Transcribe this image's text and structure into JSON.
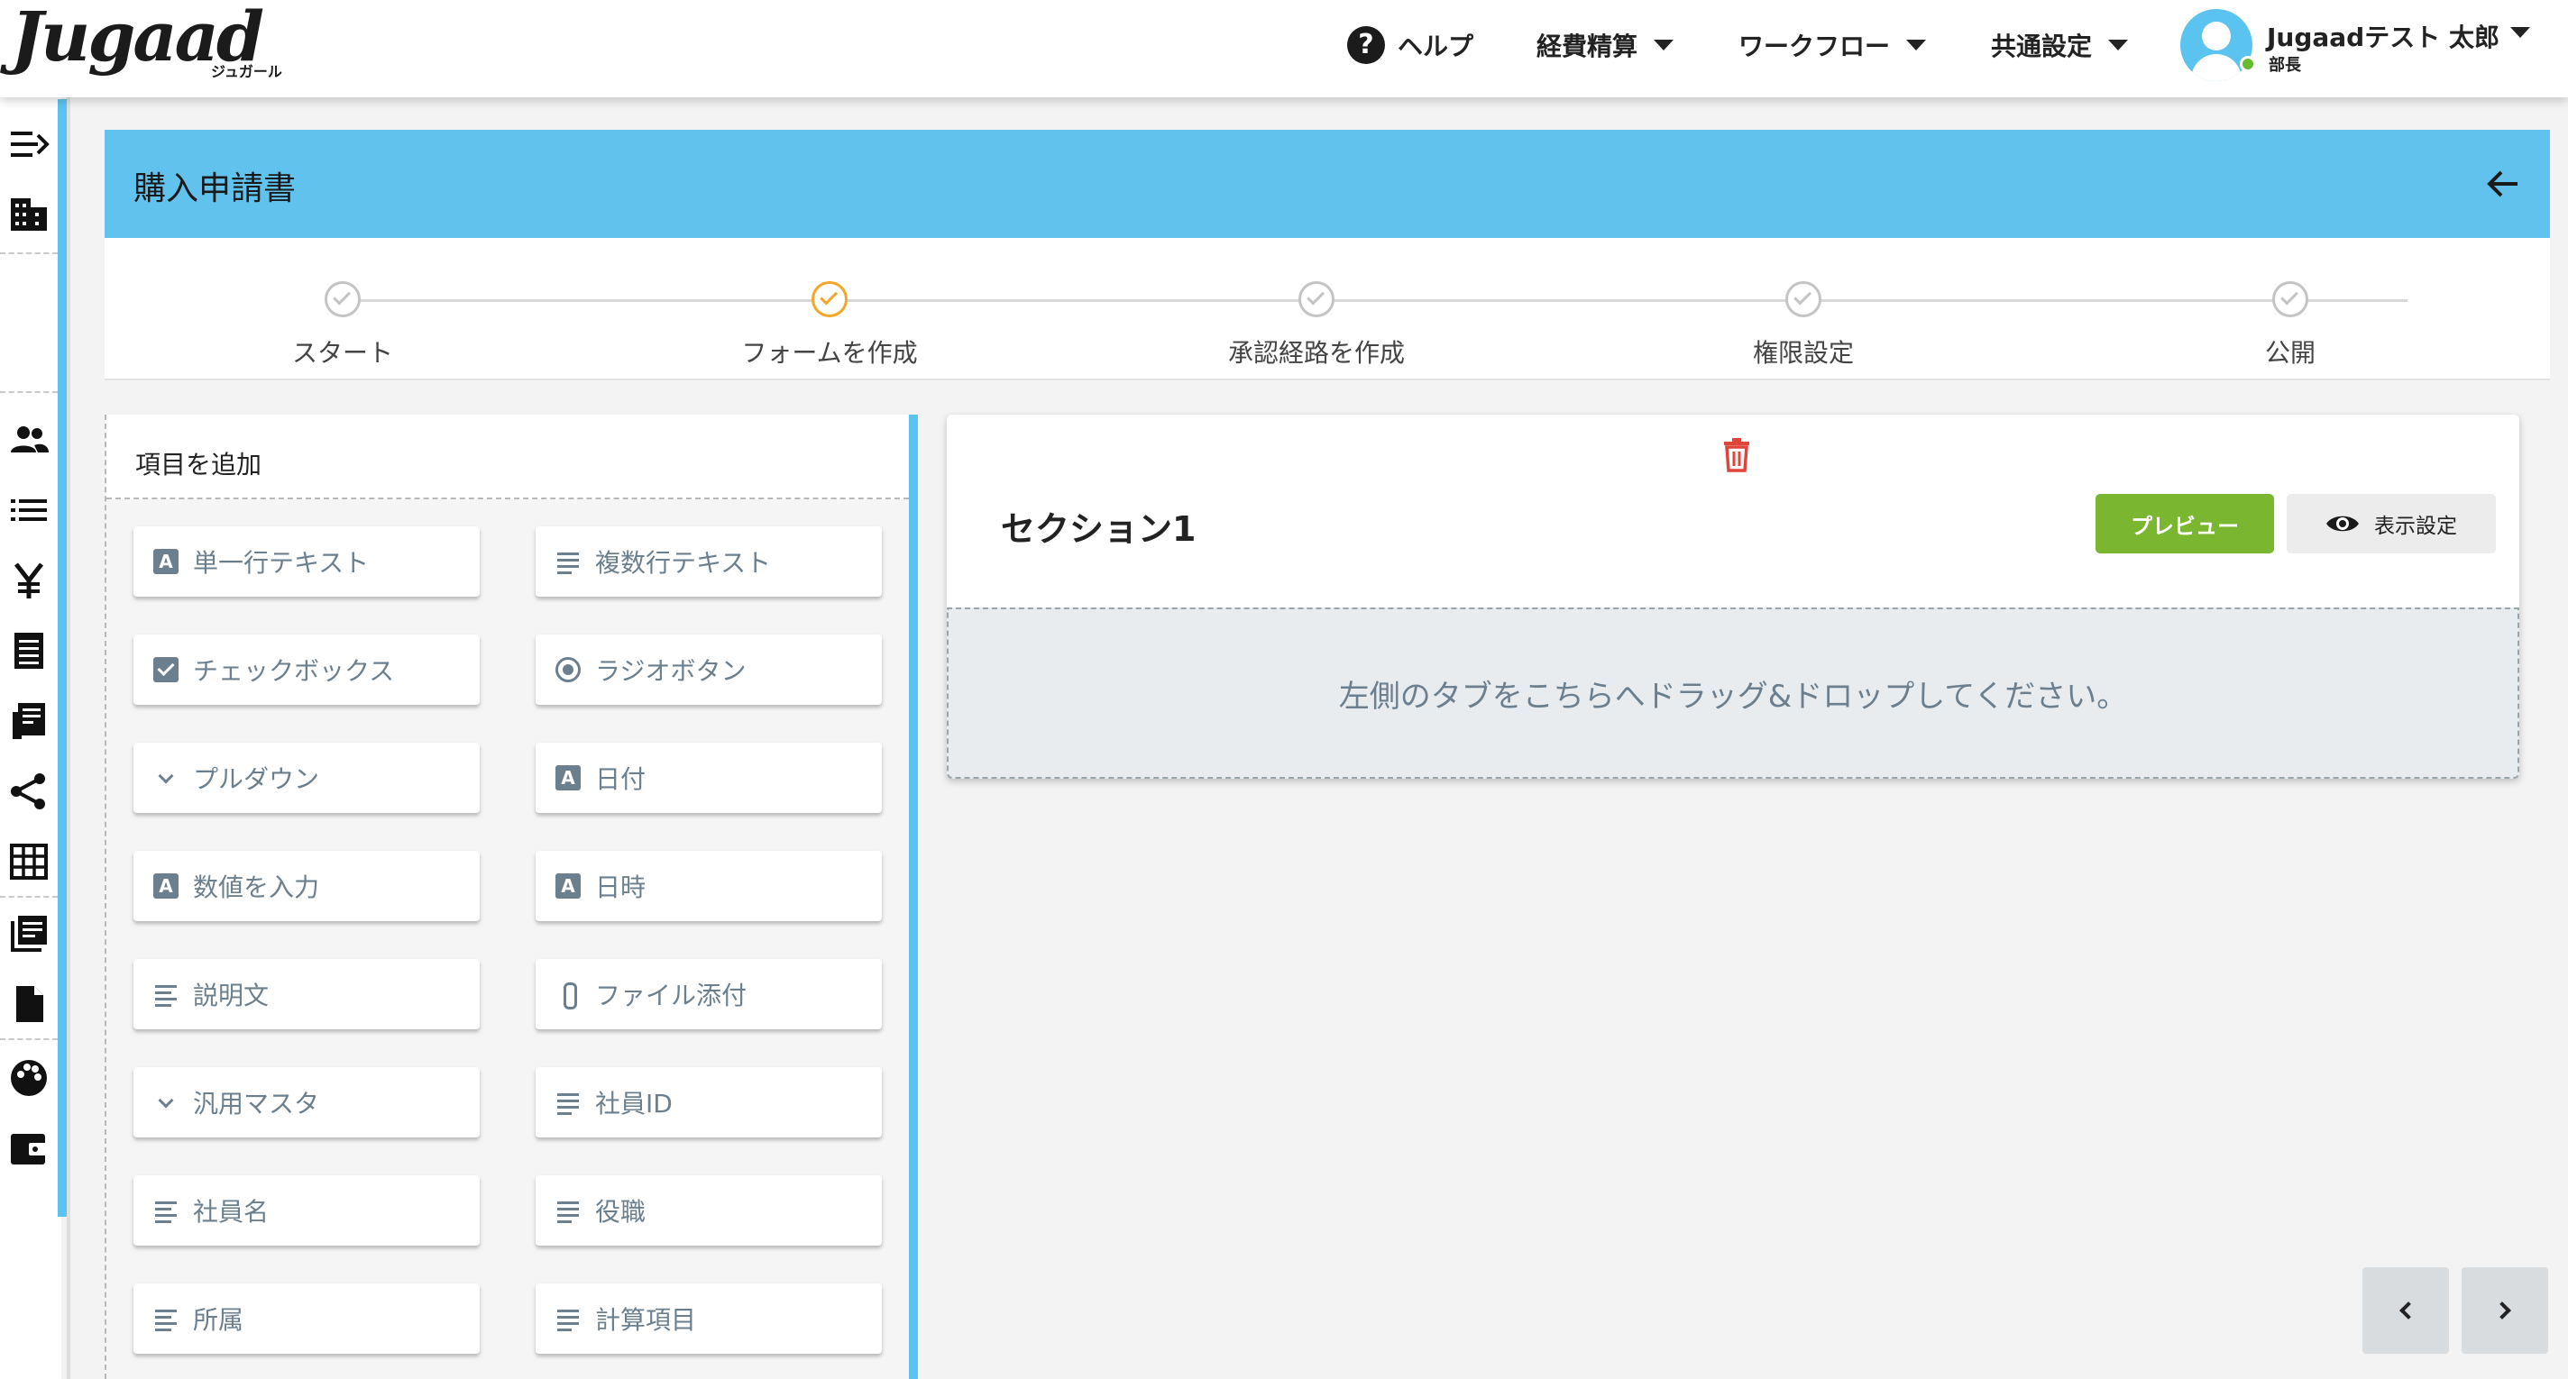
{
  "app": {
    "logo_text": "Jugaad",
    "logo_sub": "ジュガール"
  },
  "header": {
    "help_label": "ヘルプ",
    "menus": [
      "経費精算",
      "ワークフロー",
      "共通設定"
    ],
    "user": {
      "name": "Jugaadテスト 太郎",
      "role": "部長",
      "status_color": "#66bb2e"
    }
  },
  "sidebar": {
    "icons": [
      "collapse-menu-icon",
      "building-icon",
      "users-icon",
      "list-icon",
      "yen-icon",
      "receipt-icon",
      "invoice-icon",
      "share-icon",
      "table-icon",
      "library-icon",
      "document-icon",
      "palette-icon",
      "wallet-icon"
    ]
  },
  "page": {
    "title": "購入申請書"
  },
  "stepper": {
    "steps": [
      {
        "label": "スタート",
        "state": "done"
      },
      {
        "label": "フォームを作成",
        "state": "active"
      },
      {
        "label": "承認経路を作成",
        "state": "pending"
      },
      {
        "label": "権限設定",
        "state": "pending"
      },
      {
        "label": "公開",
        "state": "pending"
      }
    ],
    "active_color": "#f3a628"
  },
  "palette": {
    "title": "項目を追加",
    "items": [
      {
        "label": "単一行テキスト",
        "icon": "text-a-icon"
      },
      {
        "label": "複数行テキスト",
        "icon": "multiline-icon"
      },
      {
        "label": "チェックボックス",
        "icon": "checkbox-icon"
      },
      {
        "label": "ラジオボタン",
        "icon": "radio-icon"
      },
      {
        "label": "プルダウン",
        "icon": "chevron-down-icon"
      },
      {
        "label": "日付",
        "icon": "text-a-icon"
      },
      {
        "label": "数値を入力",
        "icon": "text-a-icon"
      },
      {
        "label": "日時",
        "icon": "text-a-icon"
      },
      {
        "label": "説明文",
        "icon": "align-left-icon"
      },
      {
        "label": "ファイル添付",
        "icon": "paperclip-icon"
      },
      {
        "label": "汎用マスタ",
        "icon": "chevron-down-icon"
      },
      {
        "label": "社員ID",
        "icon": "multiline-icon"
      },
      {
        "label": "社員名",
        "icon": "align-left-icon"
      },
      {
        "label": "役職",
        "icon": "multiline-icon"
      },
      {
        "label": "所属",
        "icon": "align-left-icon"
      },
      {
        "label": "計算項目",
        "icon": "multiline-icon"
      }
    ]
  },
  "section": {
    "title": "セクション1",
    "preview_label": "プレビュー",
    "display_settings_label": "表示設定",
    "dropzone_text": "左側のタブをこちらへドラッグ&ドロップしてください。",
    "preview_color": "#7ab62f",
    "delete_color": "#e0443a"
  },
  "colors": {
    "accent": "#62c2ee"
  }
}
